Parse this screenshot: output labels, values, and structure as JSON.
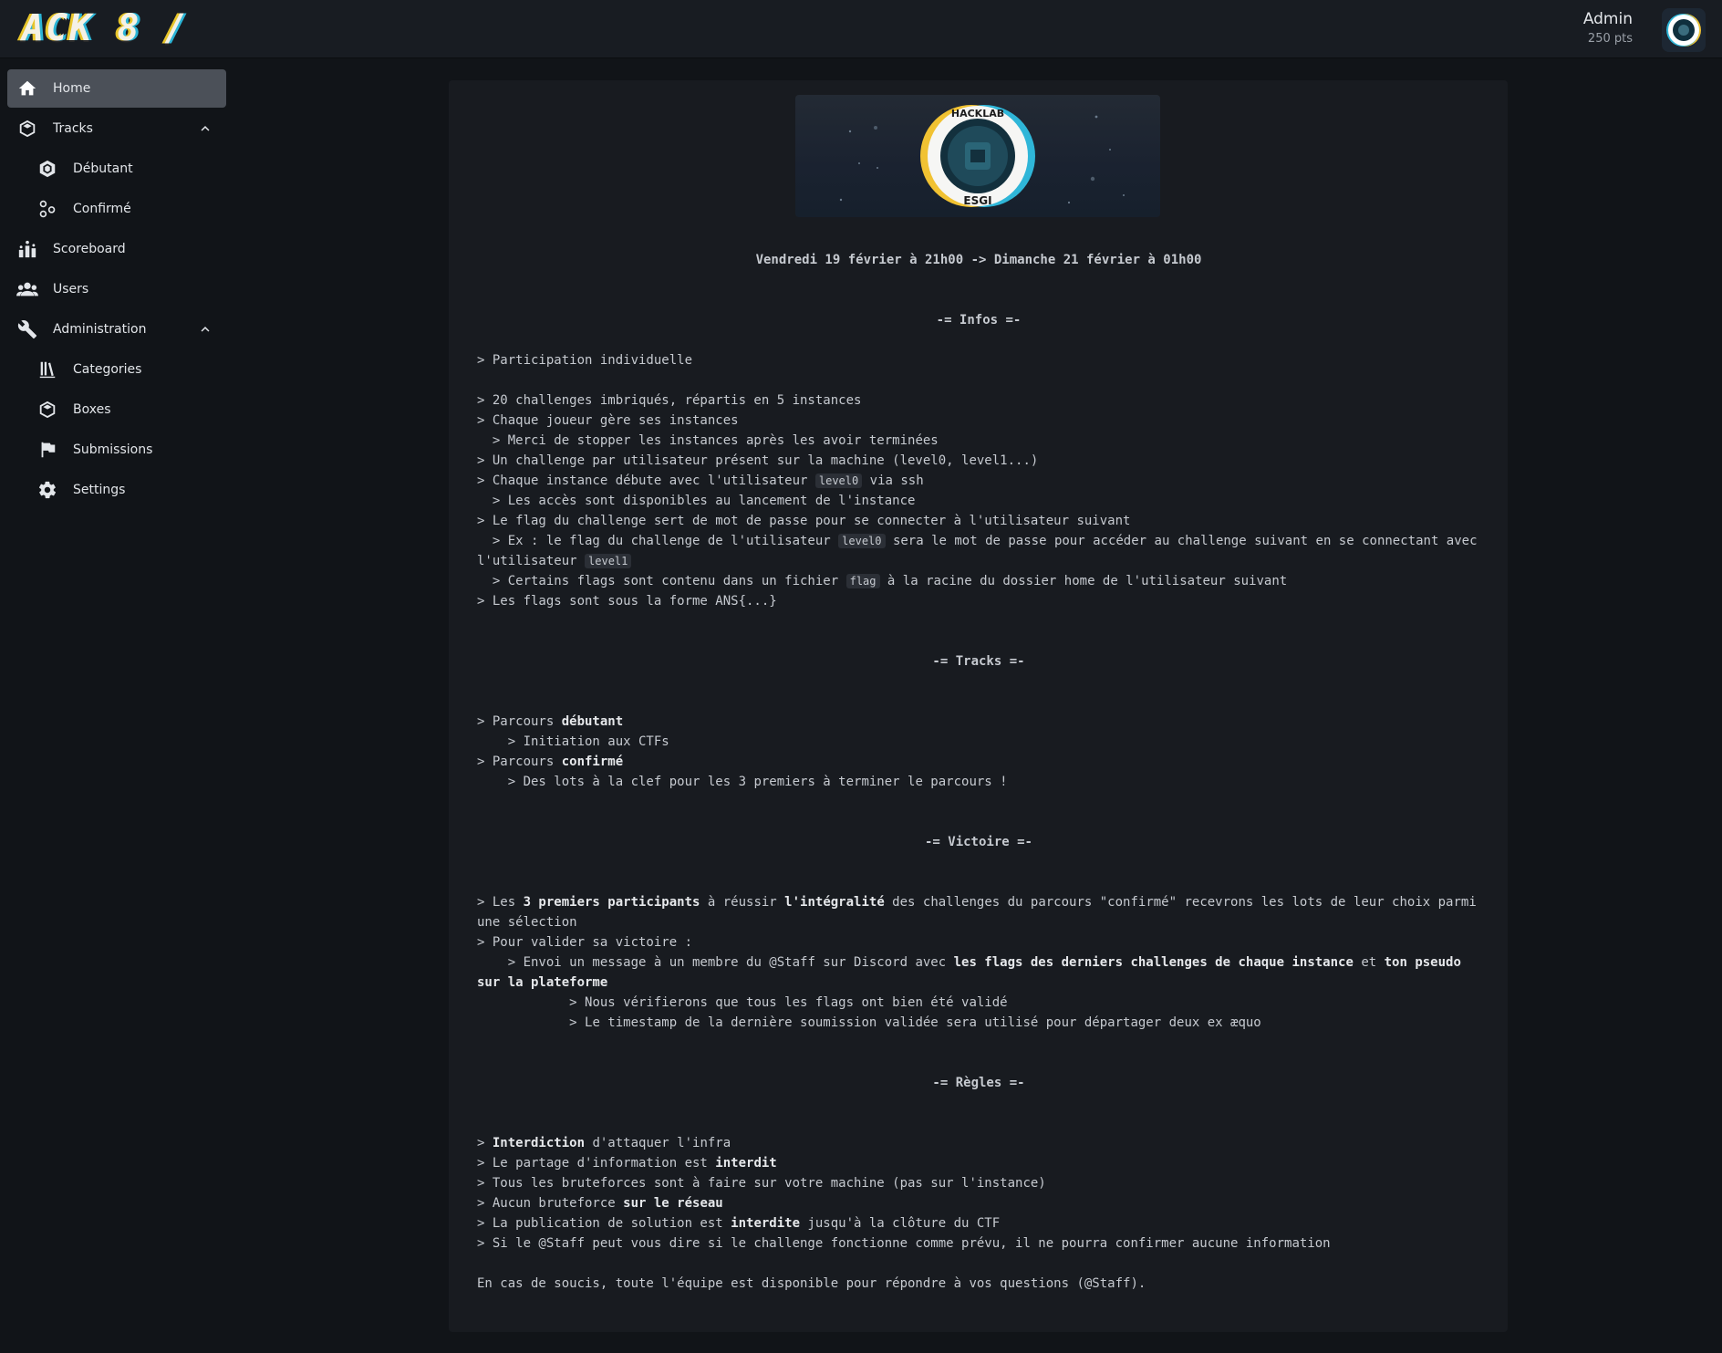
{
  "header": {
    "logo_text": "ACK 8 /",
    "user_name": "Admin",
    "user_points": "250 pts"
  },
  "sidebar": {
    "home": "Home",
    "tracks": "Tracks",
    "tracks_debutant": "Débutant",
    "tracks_confirme": "Confirmé",
    "scoreboard": "Scoreboard",
    "users": "Users",
    "administration": "Administration",
    "admin_categories": "Categories",
    "admin_boxes": "Boxes",
    "admin_submissions": "Submissions",
    "admin_settings": "Settings"
  },
  "banner": {
    "top_text": "HACKLAB",
    "bottom_text": "ESGI"
  },
  "content": {
    "dates": "Vendredi 19 février à 21h00 -> Dimanche 21 février à 01h00",
    "infos_title": "-= Infos =-",
    "infos": {
      "l1": "> Participation individuelle",
      "l2": "> 20 challenges imbriqués, répartis en 5 instances",
      "l3": "> Chaque joueur gère ses instances",
      "l4": "  > Merci de stopper les instances après les avoir terminées",
      "l5": "> Un challenge par utilisateur présent sur la machine (level0, level1...)",
      "l6a": "> Chaque instance débute avec l'utilisateur ",
      "l6code": "level0",
      "l6b": " via ssh",
      "l7": "  > Les accès sont disponibles au lancement de l'instance",
      "l8": "> Le flag du challenge sert de mot de passe pour se connecter à l'utilisateur suivant",
      "l9a": "  > Ex : le flag du challenge de l'utilisateur ",
      "l9code": "level0",
      "l9b": " sera le mot de passe pour accéder au challenge suivant en se connectant avec l'utilisateur ",
      "l9code2": "level1",
      "l10a": "  > Certains flags sont contenu dans un fichier ",
      "l10code": "flag",
      "l10b": " à la racine du dossier home de l'utilisateur suivant",
      "l11": "> Les flags sont sous la forme ANS{...}"
    },
    "tracks_title": "-= Tracks =-",
    "tracks": {
      "l1a": "> Parcours ",
      "l1b": "débutant",
      "l2": "    > Initiation aux CTFs",
      "l3a": "> Parcours ",
      "l3b": "confirmé",
      "l4": "    > Des lots à la clef pour les 3 premiers à terminer le parcours !"
    },
    "victoire_title": "-= Victoire =-",
    "victoire": {
      "l1a": "> Les ",
      "l1b": "3 premiers participants",
      "l1c": " à réussir ",
      "l1d": "l'intégralité",
      "l1e": " des challenges du parcours \"confirmé\" recevrons les lots de leur choix parmi une sélection",
      "l2": "> Pour valider sa victoire :",
      "l3a": "    > Envoi un message à un membre du @Staff sur Discord avec ",
      "l3b": "les flags des derniers challenges de chaque instance",
      "l3c": " et ",
      "l3d": "ton pseudo sur la plateforme",
      "l4": "            > Nous vérifierons que tous les flags ont bien été validé",
      "l5": "            > Le timestamp de la dernière soumission validée sera utilisé pour départager deux ex æquo"
    },
    "regles_title": "-= Règles =-",
    "regles": {
      "l1a": "> ",
      "l1b": "Interdiction",
      "l1c": " d'attaquer l'infra",
      "l2a": "> Le partage d'information est ",
      "l2b": "interdit",
      "l3": "> Tous les bruteforces sont à faire sur votre machine (pas sur l'instance)",
      "l4a": "> Aucun bruteforce ",
      "l4b": "sur le réseau",
      "l5a": "> La publication de solution est ",
      "l5b": "interdite",
      "l5c": " jusqu'à la clôture du CTF",
      "l6": "> Si le @Staff peut vous dire si le challenge fonctionne comme prévu, il ne pourra confirmer aucune information"
    },
    "footer": "En cas de soucis, toute l'équipe est disponible pour répondre à vos questions (@Staff)."
  }
}
